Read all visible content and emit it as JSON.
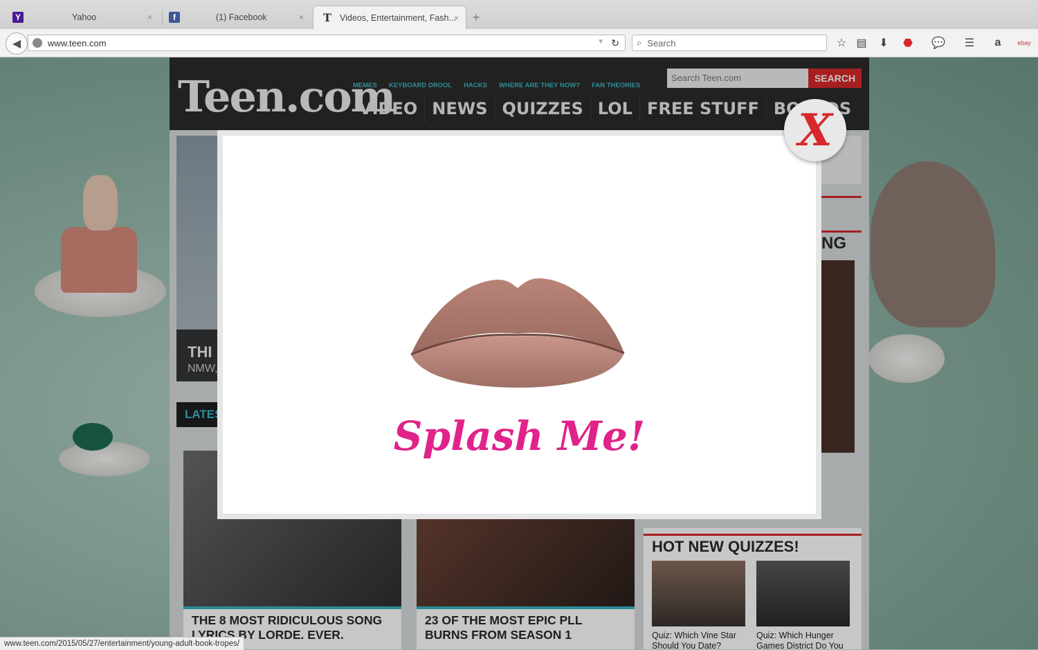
{
  "browser": {
    "tabs": [
      {
        "label": "Yahoo",
        "icon": "yahoo-icon",
        "active": false
      },
      {
        "label": "(1) Facebook",
        "icon": "facebook-icon",
        "active": false
      },
      {
        "label": "Videos, Entertainment, Fash...",
        "icon": "teen-icon",
        "active": true
      }
    ],
    "close_glyph": "×",
    "new_tab_glyph": "+",
    "url": "www.teen.com",
    "search_placeholder": "Search",
    "status_url": "www.teen.com/2015/05/27/entertainment/young-adult-book-tropes/"
  },
  "site": {
    "logo": "Teen.com",
    "subnav": [
      "MEMES",
      "KEYBOARD DROOL",
      "HACKS",
      "WHERE ARE THEY NOW?",
      "FAN THEORIES"
    ],
    "mainnav": [
      "VIDEO",
      "NEWS",
      "QUIZZES",
      "LOL",
      "FREE STUFF",
      "BOARDS"
    ],
    "search_placeholder": "Search Teen.com",
    "search_button": "SEARCH",
    "feature_title_partial": "THI",
    "feature_sub_partial": "NMW,",
    "latest_partial": "LATES",
    "trending_partial": "NG",
    "cards": [
      {
        "title": "THE 8 MOST RIDICULOUS SONG LYRICS BY LORDE. EVER."
      },
      {
        "title": "23 OF THE MOST EPIC PLL BURNS FROM SEASON 1"
      }
    ],
    "quizzes_header": "HOT NEW QUIZZES!",
    "quizzes": [
      {
        "title": "Quiz: Which Vine Star Should You Date?"
      },
      {
        "title": "Quiz: Which Hunger Games District Do You"
      }
    ]
  },
  "modal": {
    "text": "Splash Me!",
    "close_glyph": "X"
  },
  "colors": {
    "accent_red": "#d7282b",
    "accent_teal": "#3fb6c4",
    "splash_pink": "#e0238a"
  }
}
